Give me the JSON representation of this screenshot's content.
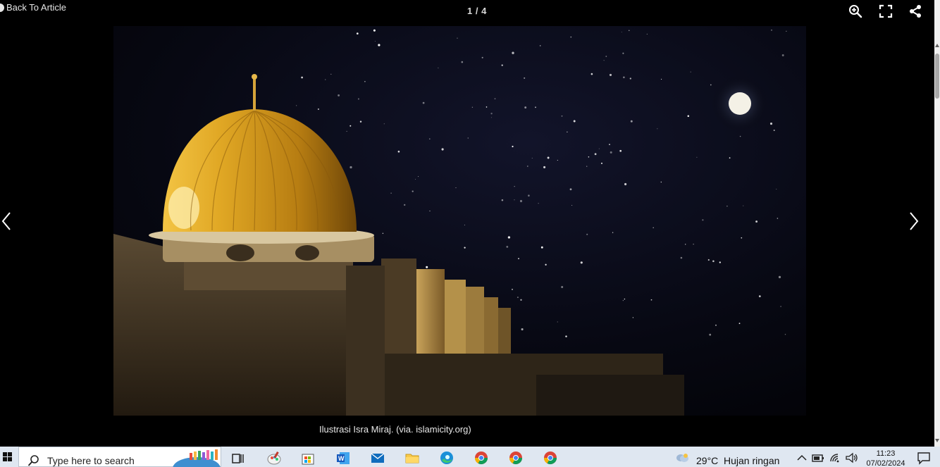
{
  "viewer": {
    "back_label": "Back To Article",
    "counter": "1 / 4",
    "current_index": 1,
    "total": 4,
    "caption": "Ilustrasi Isra Miraj. (via. islamicity.org)",
    "tools": [
      "zoom-in-icon",
      "fullscreen-icon",
      "share-icon"
    ],
    "nav": [
      "previous-arrow-icon",
      "next-arrow-icon"
    ]
  },
  "taskbar": {
    "search_placeholder": "Type here to search",
    "apps": [
      "task-view-icon",
      "paint-icon",
      "microsoft-store-icon",
      "word-icon",
      "mail-icon",
      "file-explorer-icon",
      "edge-icon",
      "chrome-icon",
      "chrome-icon",
      "chrome-icon"
    ],
    "weather_temp": "29°C",
    "weather_desc": "Hujan ringan",
    "time": "11:23",
    "date": "07/02/2024"
  },
  "colors": {
    "background": "#000000",
    "taskbar": "#dfe7f1",
    "dome_gold": "#d4a52a"
  }
}
